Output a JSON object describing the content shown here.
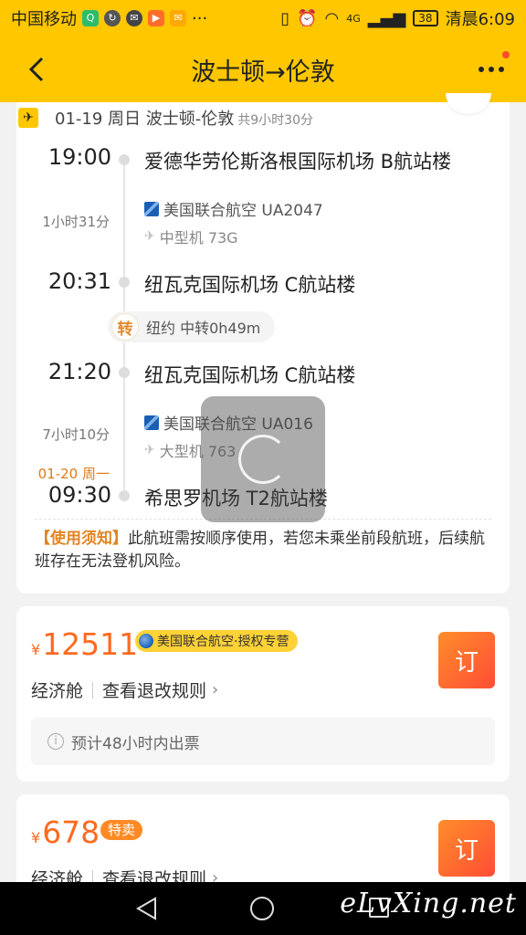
{
  "status_bar": {
    "carrier": "中国移动",
    "time": "清晨6:09",
    "battery": "38",
    "network": "4G",
    "more": "···"
  },
  "header": {
    "title": "波士顿→伦敦"
  },
  "itinerary": {
    "summary": "01-19 周日 波士顿-伦敦",
    "total_duration": "共9小时30分",
    "segments": [
      {
        "dep_time": "19:00",
        "dep_airport": "爱德华劳伦斯洛根国际机场 B航站楼",
        "duration": "1小时31分",
        "airline": "美国联合航空 UA2047",
        "aircraft": "中型机 73G",
        "arr_time": "20:31",
        "arr_airport": "纽瓦克国际机场 C航站楼"
      },
      {
        "dep_time": "21:20",
        "dep_airport": "纽瓦克国际机场 C航站楼",
        "duration": "7小时10分",
        "airline": "美国联合航空 UA016",
        "aircraft": "大型机 763",
        "arr_date": "01-20 周一",
        "arr_time": "09:30",
        "arr_airport": "希思罗机场 T2航站楼"
      }
    ],
    "transfer": {
      "badge": "转",
      "text": "纽约 中转0h49m"
    },
    "notice": {
      "label": "【使用须知】",
      "text": "此航班需按顺序使用，若您未乘坐前段航班，后续航班存在无法登机风险。"
    }
  },
  "offers": [
    {
      "currency": "¥",
      "price": "12511",
      "tag": "美国联合航空·授权专营",
      "cabin": "经济舱",
      "rules": "查看退改规则",
      "book": "订",
      "ticket_info": "预计48小时内出票"
    },
    {
      "currency": "¥",
      "price": "678",
      "tag": "特卖",
      "cabin": "经济舱",
      "rules": "查看退改规则",
      "book": "订"
    }
  ],
  "watermark": "eLvXing.net",
  "colors": {
    "brand_yellow": "#ffc700",
    "price_orange": "#ff6a1e",
    "book_gradient_start": "#ff8d2a",
    "book_gradient_end": "#ff4d35"
  }
}
